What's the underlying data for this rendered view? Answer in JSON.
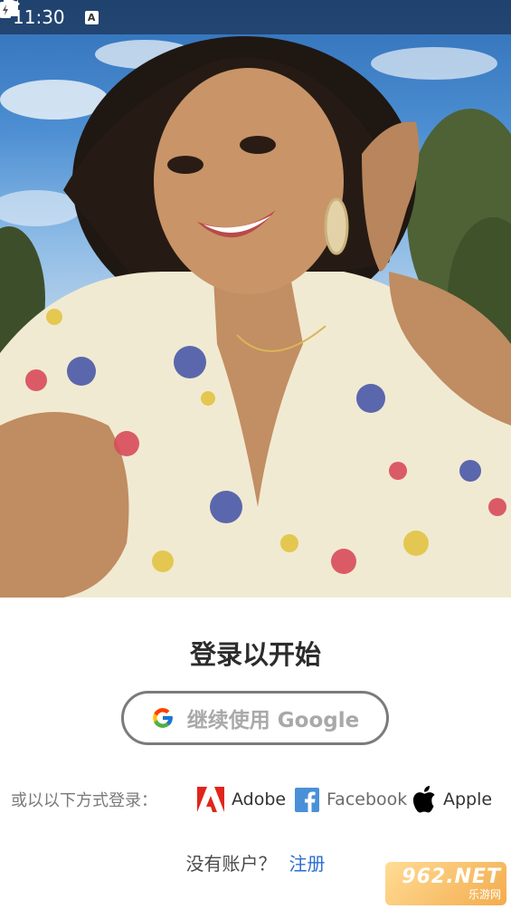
{
  "status_bar": {
    "time": "11:30",
    "notification_icon": "a-square-icon",
    "icons": [
      "vibrate-icon",
      "wifi-icon",
      "signal-icon",
      "battery-charging-icon"
    ]
  },
  "hero": {
    "image": "smiling-woman-selfie-photo"
  },
  "login": {
    "title": "登录以开始",
    "google_button": {
      "label": "继续使用 Google",
      "icon": "google-g-icon"
    },
    "other_methods": {
      "label": "或以以下方式登录：",
      "providers": [
        {
          "label": "Adobe",
          "icon": "adobe-icon",
          "color": "#e1251b"
        },
        {
          "label": "Facebook",
          "icon": "facebook-icon",
          "color": "#4a90d9"
        },
        {
          "label": "Apple",
          "icon": "apple-icon",
          "color": "#000000"
        }
      ]
    },
    "signup": {
      "question": "没有账户？",
      "link": "注册"
    }
  },
  "watermark": {
    "top": "962.NET",
    "bottom": "乐游网"
  },
  "colors": {
    "link": "#2b6fd1",
    "title": "#2c2c2c",
    "button_border": "#7b7b7b"
  }
}
